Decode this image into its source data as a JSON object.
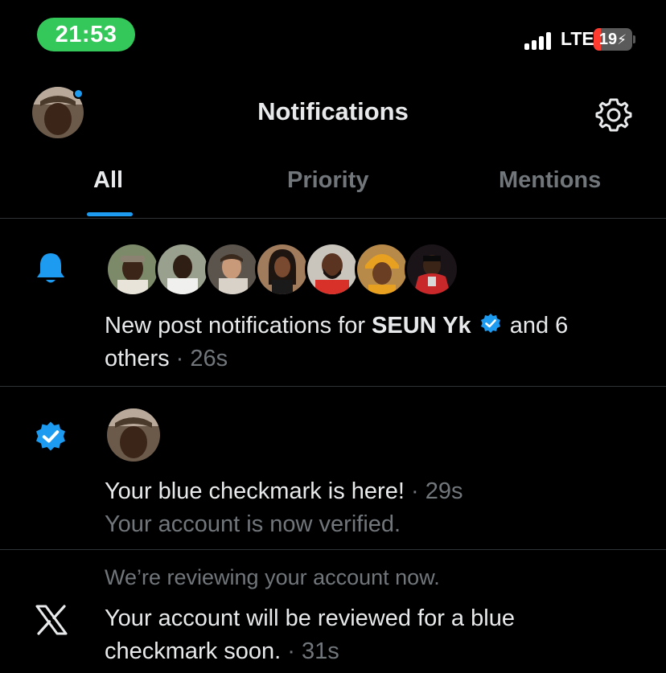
{
  "status_bar": {
    "time": "21:53",
    "network": "LTE",
    "battery_level": "19",
    "battery_fraction": 0.19,
    "time_pill_color": "#34c759",
    "battery_color": "#ff3b30"
  },
  "header": {
    "title": "Notifications",
    "profile_icon": "avatar",
    "settings_icon": "gear-icon"
  },
  "tabs": [
    {
      "label": "All",
      "active": true
    },
    {
      "label": "Priority",
      "active": false
    },
    {
      "label": "Mentions",
      "active": false
    }
  ],
  "notifications": [
    {
      "icon": "bell-icon",
      "avatar_count": 7,
      "text_prefix": "New post notifications for ",
      "name": "SEUN Yk",
      "text_suffix": " and 6",
      "text_line2": "others",
      "separator": " · ",
      "time": "26s"
    },
    {
      "icon": "verified-badge-icon",
      "title": "Your blue checkmark is here!",
      "separator": " · ",
      "time": "29s",
      "subtitle": "Your account is now verified."
    },
    {
      "icon": "x-logo-icon",
      "header": "We’re reviewing your account now.",
      "line1": "Your account will be reviewed for a blue",
      "line2": "checkmark soon.",
      "separator": " · ",
      "time": "31s"
    }
  ],
  "colors": {
    "accent": "#1d9bf0",
    "background": "#000000",
    "text": "#e7e9ea",
    "muted": "#71767b",
    "divider": "#2f3336"
  }
}
